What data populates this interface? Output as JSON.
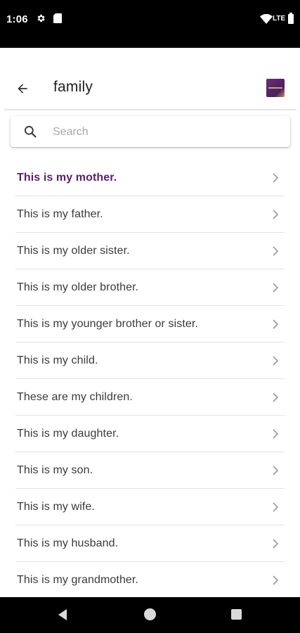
{
  "status_bar": {
    "time": "1:06",
    "network_label": "LTE",
    "icons": [
      "gear-icon",
      "sd-card-icon",
      "wifi-icon",
      "battery-icon"
    ]
  },
  "app_bar": {
    "title": "family",
    "back_icon": "arrow-left-icon"
  },
  "search": {
    "placeholder": "Search",
    "value": ""
  },
  "phrases": [
    {
      "label": "This is my mother.",
      "active": true
    },
    {
      "label": "This is my father."
    },
    {
      "label": "This is my older sister."
    },
    {
      "label": "This is my older brother."
    },
    {
      "label": "This is my younger brother or sister."
    },
    {
      "label": "This is my child."
    },
    {
      "label": "These are my children."
    },
    {
      "label": "This is my daughter."
    },
    {
      "label": "This is my son."
    },
    {
      "label": "This is my wife."
    },
    {
      "label": "This is my husband."
    },
    {
      "label": "This is my grandmother."
    }
  ],
  "colors": {
    "accent": "#5b1f6b",
    "text": "#3a3a3a",
    "divider": "#e3e3e3",
    "system_bar": "#000000"
  }
}
